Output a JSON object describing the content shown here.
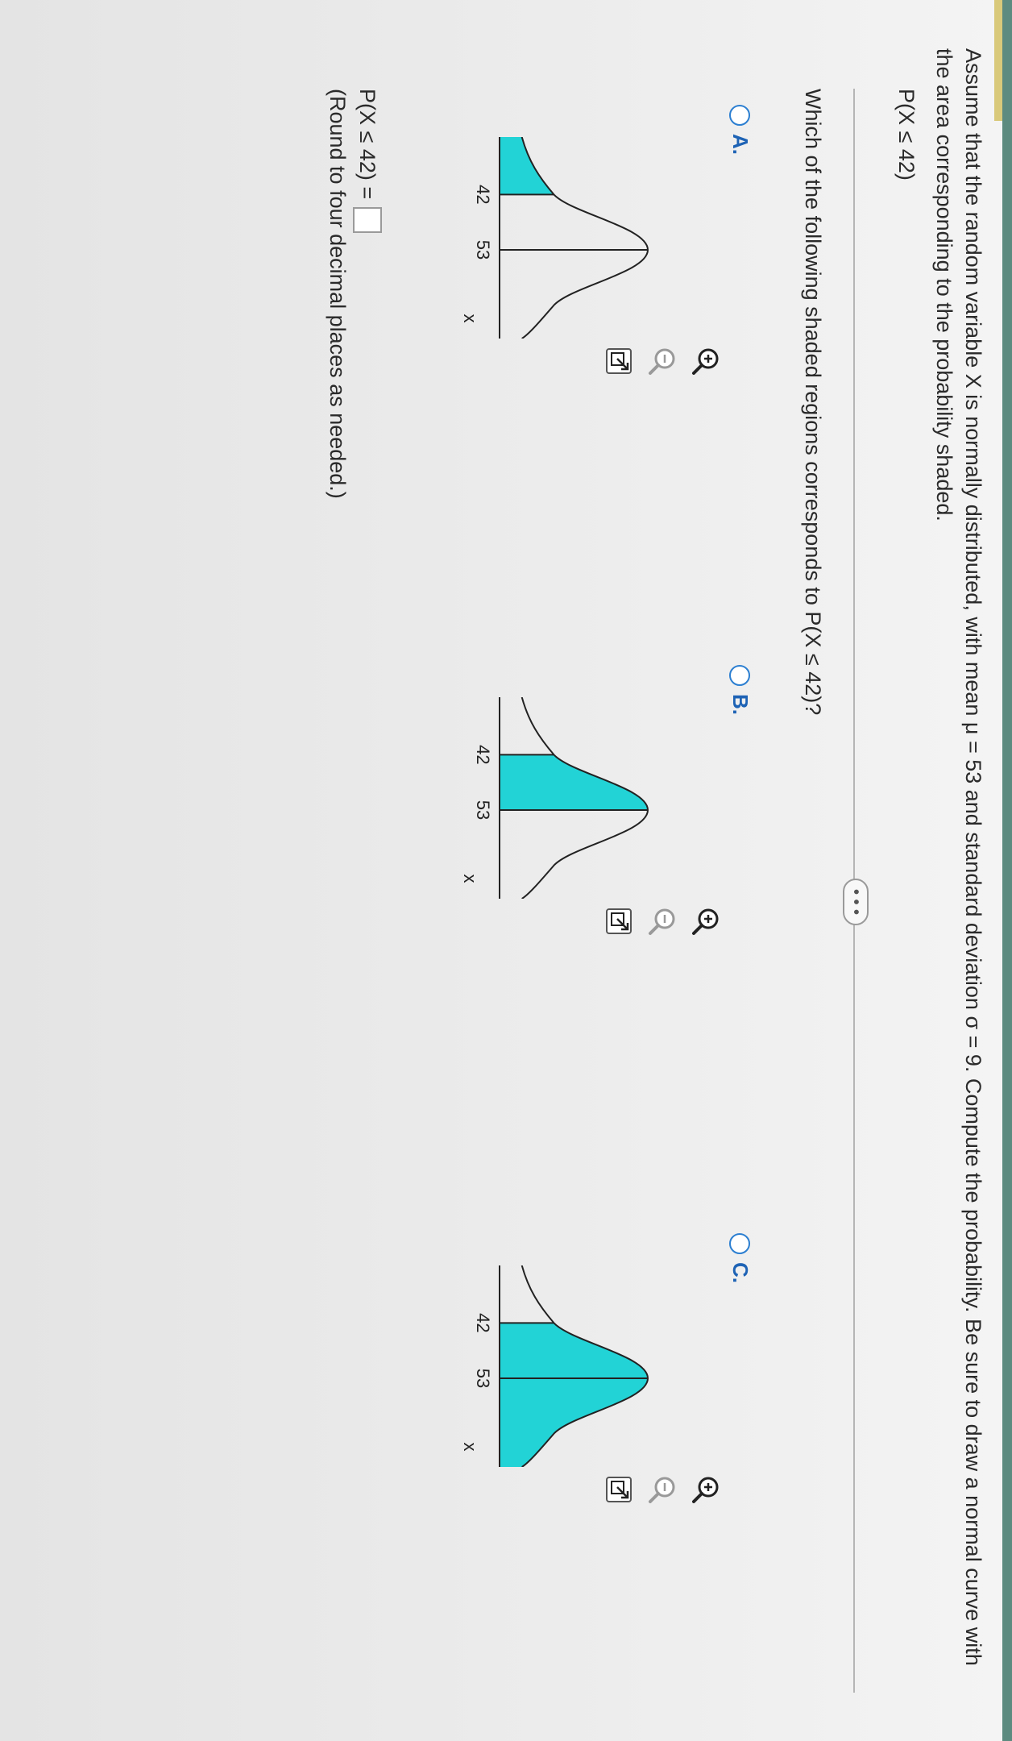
{
  "question": {
    "text": "Assume that the random variable X is normally distributed, with mean μ = 53 and standard deviation σ = 9. Compute the probability. Be sure to draw a normal curve with the area corresponding to the probability shaded.",
    "probability": "P(X ≤ 42)",
    "more_label": "• • •",
    "which": "Which of the following shaded regions corresponds to P(X ≤ 42)?"
  },
  "options": [
    {
      "letter": "A.",
      "tick_left": "42",
      "tick_right": "53",
      "axis": "x",
      "shading": "left of 42"
    },
    {
      "letter": "B.",
      "tick_left": "42",
      "tick_right": "53",
      "axis": "x",
      "shading": "between 42 and 53"
    },
    {
      "letter": "C.",
      "tick_left": "42",
      "tick_right": "53",
      "axis": "x",
      "shading": "right of 42"
    }
  ],
  "tool_icons": [
    "zoom-in-icon",
    "zoom-out-icon",
    "popout-icon"
  ],
  "answer": {
    "label": "P(X ≤ 42) =",
    "value": "",
    "hint": "(Round to four decimal places as needed.)"
  },
  "colors": {
    "shade": "#22d3d6",
    "accent": "#1e63b5",
    "radio": "#2c7fd1"
  }
}
